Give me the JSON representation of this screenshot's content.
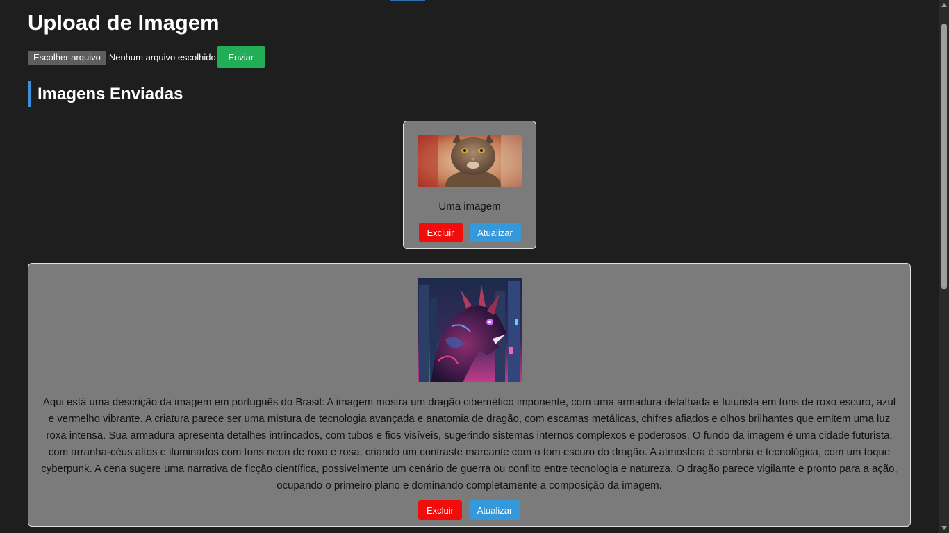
{
  "page": {
    "title": "Upload de Imagem"
  },
  "upload": {
    "choose_label": "Escolher arquivo",
    "no_file_label": "Nenhum arquivo escolhido",
    "submit_label": "Enviar"
  },
  "gallery": {
    "heading": "Imagens Enviadas",
    "cards": [
      {
        "image": "cat-photo",
        "description": "Uma imagem",
        "delete_label": "Excluir",
        "update_label": "Atualizar"
      },
      {
        "image": "cyberpunk-dragon",
        "description": "Aqui está uma descrição da imagem em português do Brasil: A imagem mostra um dragão cibernético imponente, com uma armadura detalhada e futurista em tons de roxo escuro, azul e vermelho vibrante. A criatura parece ser uma mistura de tecnologia avançada e anatomia de dragão, com escamas metálicas, chifres afiados e olhos brilhantes que emitem uma luz roxa intensa. Sua armadura apresenta detalhes intrincados, com tubos e fios visíveis, sugerindo sistemas internos complexos e poderosos. O fundo da imagem é uma cidade futurista, com arranha-céus altos e iluminados com tons neon de roxo e rosa, criando um contraste marcante com o tom escuro do dragão. A atmosfera é sombria e tecnológica, com um toque cyberpunk. A cena sugere uma narrativa de ficção científica, possivelmente um cenário de guerra ou conflito entre tecnologia e natureza. O dragão parece vigilante e pronto para a ação, ocupando o primeiro plano e dominando completamente a composição da imagem.",
        "delete_label": "Excluir",
        "update_label": "Atualizar"
      }
    ]
  },
  "colors": {
    "background": "#1e1e1e",
    "card": "#7b7b7b",
    "submit": "#22ad57",
    "delete": "#f20d0d",
    "update": "#3498db",
    "accent": "#3b8edc"
  }
}
